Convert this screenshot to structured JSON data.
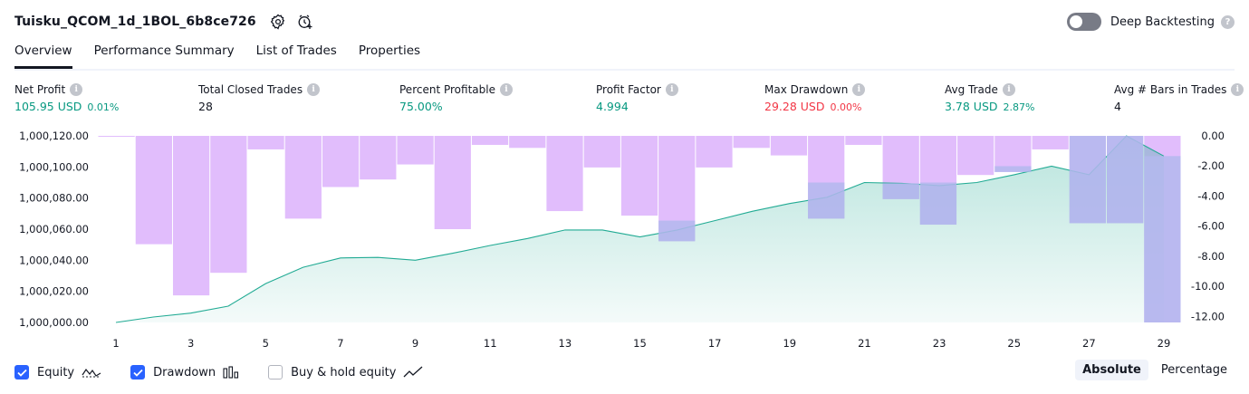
{
  "header": {
    "title": "Tuisku_QCOM_1d_1BOL_6b8ce726",
    "deep_backtesting_label": "Deep Backtesting",
    "deep_backtesting_enabled": false
  },
  "tabs": [
    {
      "label": "Overview",
      "active": true
    },
    {
      "label": "Performance Summary",
      "active": false
    },
    {
      "label": "List of Trades",
      "active": false
    },
    {
      "label": "Properties",
      "active": false
    }
  ],
  "metrics": [
    {
      "label": "Net Profit",
      "value": "105.95 USD",
      "pct": "0.01%",
      "color": "#089981"
    },
    {
      "label": "Total Closed Trades",
      "value": "28",
      "pct": "",
      "color": "#131722"
    },
    {
      "label": "Percent Profitable",
      "value": "75.00%",
      "pct": "",
      "color": "#089981"
    },
    {
      "label": "Profit Factor",
      "value": "4.994",
      "pct": "",
      "color": "#089981"
    },
    {
      "label": "Max Drawdown",
      "value": "29.28 USD",
      "pct": "0.00%",
      "color": "#f23645"
    },
    {
      "label": "Avg Trade",
      "value": "3.78 USD",
      "pct": "2.87%",
      "color": "#089981"
    },
    {
      "label": "Avg # Bars in Trades",
      "value": "4",
      "pct": "",
      "color": "#131722"
    }
  ],
  "legend": {
    "equity": {
      "label": "Equity",
      "checked": true
    },
    "drawdown": {
      "label": "Drawdown",
      "checked": true
    },
    "buy_hold": {
      "label": "Buy & hold equity",
      "checked": false
    }
  },
  "scale": {
    "absolute": "Absolute",
    "percentage": "Percentage",
    "selected": "Absolute"
  },
  "colors": {
    "equity_line": "#22ab94",
    "equity_fill": "#22ab94",
    "drawdown_bar": "#e1bdfc",
    "overlap": "#b3b9ed",
    "accent": "#2962ff"
  },
  "chart_data": {
    "type": "area",
    "x": [
      1,
      2,
      3,
      4,
      5,
      6,
      7,
      8,
      9,
      10,
      11,
      12,
      13,
      14,
      15,
      16,
      17,
      18,
      19,
      20,
      21,
      22,
      23,
      24,
      25,
      26,
      27,
      28,
      29
    ],
    "x_tick_labels": [
      "1",
      "3",
      "5",
      "7",
      "9",
      "11",
      "13",
      "15",
      "17",
      "19",
      "21",
      "23",
      "25",
      "27",
      "29"
    ],
    "equity": [
      1000000.0,
      1000003.5,
      1000006.0,
      1000010.5,
      1000025.0,
      1000035.5,
      1000041.5,
      1000041.8,
      1000040.0,
      1000044.5,
      1000049.5,
      1000054.0,
      1000059.5,
      1000059.5,
      1000055.0,
      1000059.5,
      1000065.5,
      1000071.5,
      1000076.5,
      1000080.5,
      1000090.0,
      1000089.5,
      1000088.0,
      1000090.0,
      1000095.0,
      1000100.5,
      1000095.0,
      1000120.0,
      1000107.0
    ],
    "drawdown": [
      0.0,
      -7.2,
      -10.6,
      -9.1,
      -0.9,
      -5.5,
      -3.4,
      -2.9,
      -1.9,
      -6.2,
      -0.6,
      -0.8,
      -5.0,
      -2.1,
      -5.3,
      -7.0,
      -2.1,
      -0.8,
      -1.3,
      -5.5,
      -0.6,
      -4.2,
      -5.9,
      -2.6,
      -2.4,
      -0.9,
      -5.8,
      -5.8,
      -12.4
    ],
    "y_left_ticks": [
      "1,000,000.00",
      "1,000,020.00",
      "1,000,040.00",
      "1,000,060.00",
      "1,000,080.00",
      "1,000,100.00",
      "1,000,120.00"
    ],
    "y_left_values": [
      1000000,
      1000020,
      1000040,
      1000060,
      1000080,
      1000100,
      1000120
    ],
    "y_right_ticks": [
      "0.00",
      "-2.00",
      "-4.00",
      "-6.00",
      "-8.00",
      "-10.00",
      "-12.00"
    ],
    "y_right_values": [
      0,
      -2,
      -4,
      -6,
      -8,
      -10,
      -12
    ],
    "ylim_left": [
      1000000,
      1000120
    ],
    "ylim_right": [
      -12.4,
      0
    ],
    "series": [
      {
        "name": "Equity"
      },
      {
        "name": "Drawdown"
      }
    ]
  }
}
